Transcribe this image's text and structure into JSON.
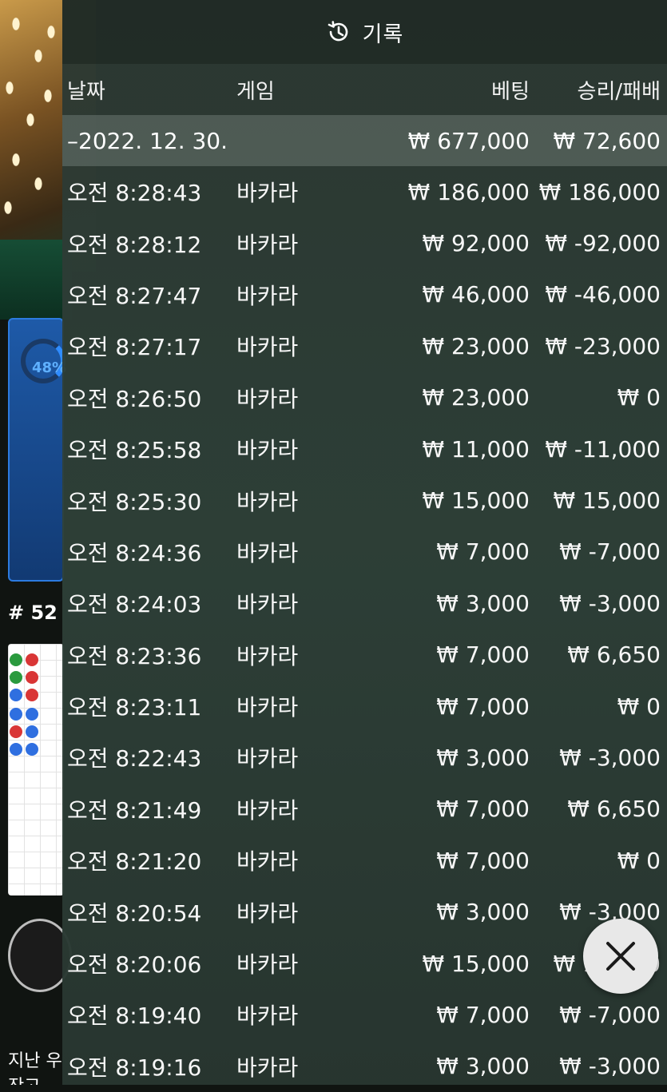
{
  "background_game": {
    "progress_percent_label": "48%",
    "progress_value": 48,
    "round_label": "# 52",
    "bottom_text": "지난 우",
    "bottom_text_2": "잔고"
  },
  "history": {
    "title": "기록",
    "columns": {
      "date": "날짜",
      "game": "게임",
      "bet": "베팅",
      "result": "승리/패배"
    },
    "date_group": {
      "date": "–2022. 12. 30.",
      "bet": "₩ 677,000",
      "result": "₩ 72,600"
    },
    "rows": [
      {
        "time": "오전 8:28:43",
        "game": "바카라",
        "bet": "₩ 186,000",
        "result": "₩ 186,000"
      },
      {
        "time": "오전 8:28:12",
        "game": "바카라",
        "bet": "₩ 92,000",
        "result": "₩ -92,000"
      },
      {
        "time": "오전 8:27:47",
        "game": "바카라",
        "bet": "₩ 46,000",
        "result": "₩ -46,000"
      },
      {
        "time": "오전 8:27:17",
        "game": "바카라",
        "bet": "₩ 23,000",
        "result": "₩ -23,000"
      },
      {
        "time": "오전 8:26:50",
        "game": "바카라",
        "bet": "₩ 23,000",
        "result": "₩ 0"
      },
      {
        "time": "오전 8:25:58",
        "game": "바카라",
        "bet": "₩ 11,000",
        "result": "₩ -11,000"
      },
      {
        "time": "오전 8:25:30",
        "game": "바카라",
        "bet": "₩ 15,000",
        "result": "₩ 15,000"
      },
      {
        "time": "오전 8:24:36",
        "game": "바카라",
        "bet": "₩ 7,000",
        "result": "₩ -7,000"
      },
      {
        "time": "오전 8:24:03",
        "game": "바카라",
        "bet": "₩ 3,000",
        "result": "₩ -3,000"
      },
      {
        "time": "오전 8:23:36",
        "game": "바카라",
        "bet": "₩ 7,000",
        "result": "₩ 6,650"
      },
      {
        "time": "오전 8:23:11",
        "game": "바카라",
        "bet": "₩ 7,000",
        "result": "₩ 0"
      },
      {
        "time": "오전 8:22:43",
        "game": "바카라",
        "bet": "₩ 3,000",
        "result": "₩ -3,000"
      },
      {
        "time": "오전 8:21:49",
        "game": "바카라",
        "bet": "₩ 7,000",
        "result": "₩ 6,650"
      },
      {
        "time": "오전 8:21:20",
        "game": "바카라",
        "bet": "₩ 7,000",
        "result": "₩ 0"
      },
      {
        "time": "오전 8:20:54",
        "game": "바카라",
        "bet": "₩ 3,000",
        "result": "₩ -3,000"
      },
      {
        "time": "오전 8:20:06",
        "game": "바카라",
        "bet": "₩ 15,000",
        "result": "₩ 14,250"
      },
      {
        "time": "오전 8:19:40",
        "game": "바카라",
        "bet": "₩ 7,000",
        "result": "₩ -7,000"
      },
      {
        "time": "오전 8:19:16",
        "game": "바카라",
        "bet": "₩ 3,000",
        "result": "₩ -3,000"
      }
    ]
  },
  "icons": {
    "history": "history-clock-icon",
    "close": "close-icon"
  },
  "colors": {
    "panel_bg": "#2e4038",
    "header_bg": "#1a221e",
    "date_row_bg": "#78847e",
    "close_bg": "#e8e8e8"
  }
}
